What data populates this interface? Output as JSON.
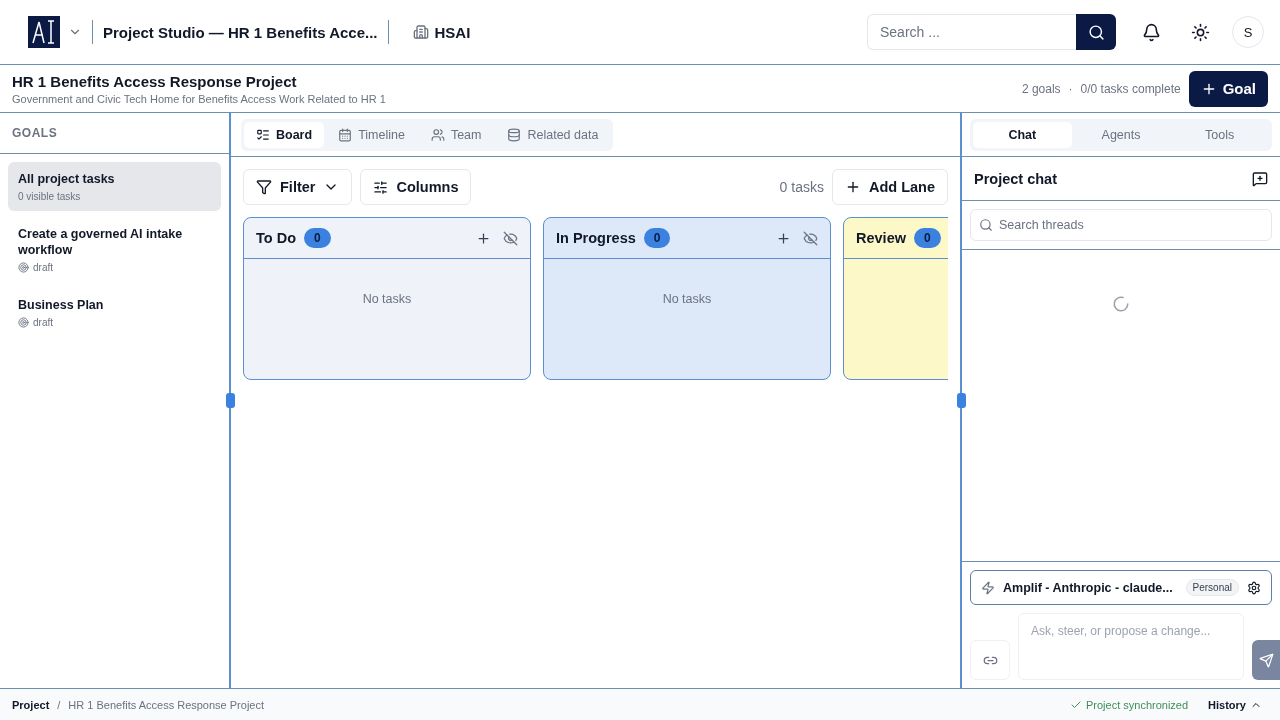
{
  "header": {
    "app_title": "Project Studio — HR 1 Benefits Acce...",
    "org": "HSAI",
    "search": {
      "placeholder": "Search ..."
    },
    "avatar": "S"
  },
  "project": {
    "title": "HR 1 Benefits Access Response Project",
    "subtitle": "Government and Civic Tech Home for Benefits Access Work Related to HR 1",
    "goals": "2 goals",
    "separator": "·",
    "tasks_complete": "0/0 tasks complete",
    "add_button": "Goal"
  },
  "sidebar": {
    "heading": "GOALS",
    "items": [
      {
        "kind": "summary",
        "title": "All project tasks",
        "subtitle": "0 visible tasks",
        "selected": true
      },
      {
        "kind": "goal",
        "title": "Create a governed AI intake workflow",
        "subtitle": "draft",
        "selected": false
      },
      {
        "kind": "goal",
        "title": "Business Plan",
        "subtitle": "draft",
        "selected": false
      }
    ]
  },
  "view_tabs": [
    {
      "kind": "board",
      "label": "Board",
      "selected": true
    },
    {
      "kind": "timeline",
      "label": "Timeline",
      "selected": false
    },
    {
      "kind": "team",
      "label": "Team",
      "selected": false
    },
    {
      "kind": "data",
      "label": "Related data",
      "selected": false
    }
  ],
  "toolbar": {
    "filter": "Filter",
    "columns": "Columns",
    "count": "0 tasks",
    "add_lane": "Add Lane"
  },
  "lanes": [
    {
      "title": "To Do",
      "count": "0",
      "color": "#eff3f9",
      "empty_text": "No tasks"
    },
    {
      "title": "In Progress",
      "count": "0",
      "color": "#dde8f8",
      "empty_text": "No tasks"
    },
    {
      "title": "Review",
      "count": "0",
      "color": "#fdf8c7"
    }
  ],
  "chat": {
    "tabs": [
      {
        "label": "Chat",
        "selected": true
      },
      {
        "label": "Agents",
        "selected": false
      },
      {
        "label": "Tools",
        "selected": false
      }
    ],
    "title": "Project chat",
    "search": {
      "placeholder": "Search threads"
    },
    "loading": true,
    "model": "Amplif - Anthropic - claude...",
    "model_badge": "Personal",
    "composer": {
      "placeholder": "Ask, steer, or propose a change..."
    }
  },
  "status_bar": {
    "breadcrumb": [
      "Project",
      "HR 1 Benefits Access Response Project"
    ],
    "breadcrumb_separator": "/",
    "sync": "Project synchronized",
    "history": "History"
  }
}
